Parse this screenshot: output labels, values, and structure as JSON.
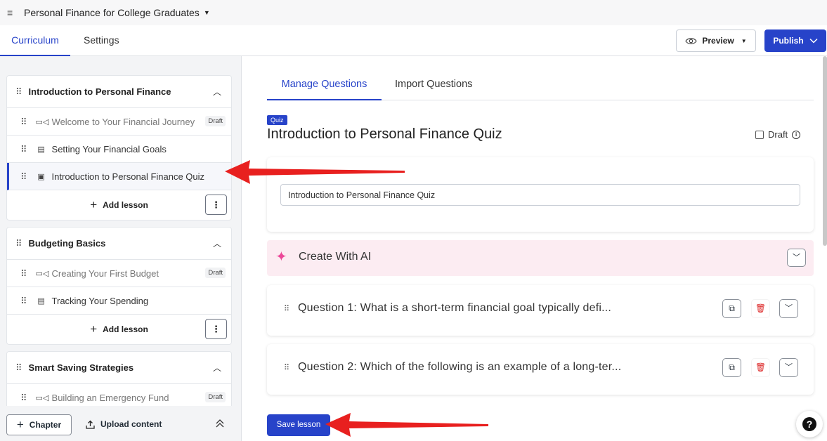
{
  "topbar": {
    "menu_icon": "hamburger-icon",
    "course_title": "Personal Finance for College Graduates"
  },
  "tabs": {
    "curriculum": "Curriculum",
    "settings": "Settings"
  },
  "header_buttons": {
    "preview": "Preview",
    "publish": "Publish"
  },
  "sidebar": {
    "sections": [
      {
        "title": "Introduction to Personal Finance",
        "lessons": [
          {
            "title": "Welcome to Your Financial Journey",
            "icon": "video-icon",
            "badge": "Draft"
          },
          {
            "title": "Setting Your Financial Goals",
            "icon": "document-icon"
          },
          {
            "title": "Introduction to Personal Finance Quiz",
            "icon": "quiz-icon"
          }
        ],
        "add_lesson": "Add lesson"
      },
      {
        "title": "Budgeting Basics",
        "lessons": [
          {
            "title": "Creating Your First Budget",
            "icon": "video-icon",
            "badge": "Draft"
          },
          {
            "title": "Tracking Your Spending",
            "icon": "document-icon"
          }
        ],
        "add_lesson": "Add lesson"
      },
      {
        "title": "Smart Saving Strategies",
        "lessons": [
          {
            "title": "Building an Emergency Fund",
            "icon": "video-icon",
            "badge": "Draft"
          }
        ]
      }
    ],
    "footer": {
      "chapter": "Chapter",
      "upload": "Upload content"
    }
  },
  "main": {
    "tabs": {
      "manage": "Manage Questions",
      "import": "Import Questions"
    },
    "badge": "Quiz",
    "title": "Introduction to Personal Finance Quiz",
    "draft_label": "Draft",
    "title_field": {
      "value": "Introduction to Personal Finance Quiz"
    },
    "ai": {
      "label": "Create With AI"
    },
    "questions": [
      "Question 1: What is a short-term financial goal typically defi...",
      "Question 2: Which of the following is an example of a long-ter..."
    ],
    "save": "Save lesson"
  },
  "colors": {
    "accent": "#2743c9",
    "ai_bg": "#fcecf2",
    "arrow": "#e8201f"
  }
}
